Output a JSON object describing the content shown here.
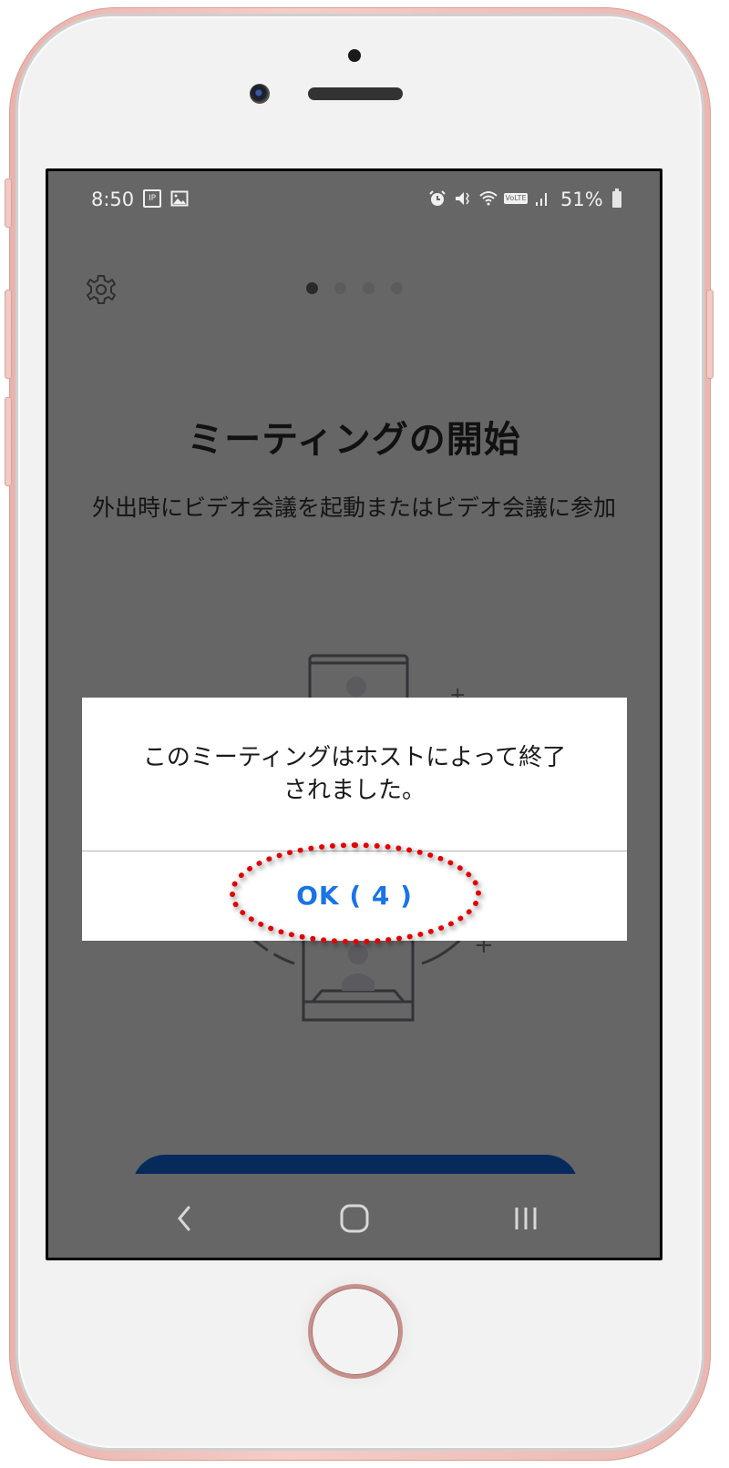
{
  "status_bar": {
    "time": "8:50",
    "left_icons": [
      "call-ip-icon",
      "image-icon"
    ],
    "right_icons": [
      "alarm-icon",
      "vibrate-mute-icon",
      "wifi-icon",
      "volte-icon",
      "signal-icon"
    ],
    "battery_percent": "51%"
  },
  "header": {
    "settings_icon": "gear-icon",
    "page_indicator": {
      "total": 4,
      "active_index": 0
    }
  },
  "onboarding": {
    "title": "ミーティングの開始",
    "subtitle": "外出時にビデオ会議を起動またはビデオ会議に参加"
  },
  "dialog": {
    "message": "このミーティングはホストによって終了\nされました。",
    "ok_label": "OK ( 4 )"
  },
  "annotation": {
    "highlight_color": "#e30000",
    "target": "dialog-ok-button"
  },
  "navigation_bar": {
    "back_icon": "back-icon",
    "home_icon": "home-icon",
    "recents_icon": "recents-icon"
  },
  "colors": {
    "overlay": "#666666",
    "primary_button": "#062a5c",
    "ok_text": "#1a73e8"
  }
}
